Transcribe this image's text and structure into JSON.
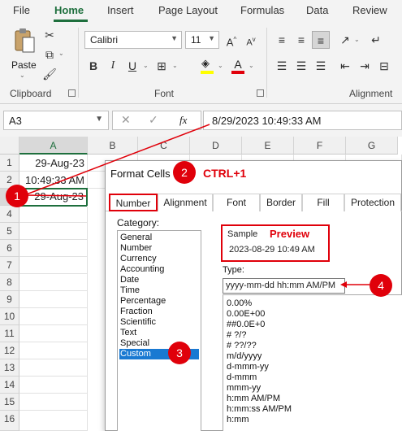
{
  "menu": {
    "tabs": [
      "File",
      "Home",
      "Insert",
      "Page Layout",
      "Formulas",
      "Data",
      "Review"
    ],
    "active": "Home"
  },
  "ribbon": {
    "clipboard": {
      "paste_label": "Paste",
      "group_label": "Clipboard"
    },
    "font": {
      "font_name": "Calibri",
      "font_size": "11",
      "group_label": "Font",
      "bold": "B",
      "italic": "I",
      "underline": "U",
      "grow": "A",
      "shrink": "A",
      "font_color_letter": "A"
    },
    "alignment": {
      "group_label": "Alignment"
    }
  },
  "formula_bar": {
    "name_box": "A3",
    "fx": "fx",
    "content": "8/29/2023  10:49:33 AM"
  },
  "grid": {
    "columns": [
      "A",
      "B",
      "C",
      "D",
      "E",
      "F",
      "G"
    ],
    "rows": [
      "1",
      "2",
      "3",
      "4",
      "5",
      "6",
      "7",
      "8",
      "9",
      "10",
      "11",
      "12",
      "13",
      "14",
      "15",
      "16"
    ],
    "cells": {
      "A1": "29-Aug-23",
      "A2": "10:49:33 AM",
      "A3": "29-Aug-23"
    }
  },
  "dialog": {
    "title": "Format Cells",
    "tabs": [
      "Number",
      "Alignment",
      "Font",
      "Border",
      "Fill",
      "Protection"
    ],
    "active_tab": "Number",
    "category_label": "Category:",
    "categories": [
      "General",
      "Number",
      "Currency",
      "Accounting",
      "Date",
      "Time",
      "Percentage",
      "Fraction",
      "Scientific",
      "Text",
      "Special",
      "Custom"
    ],
    "selected_category": "Custom",
    "sample_label": "Sample",
    "sample_value": "2023-08-29 10:49 AM",
    "type_label": "Type:",
    "type_value": "yyyy-mm-dd hh:mm AM/PM",
    "type_options": [
      "0.00%",
      "0.00E+00",
      "##0.0E+0",
      "# ?/?",
      "# ??/??",
      "m/d/yyyy",
      "d-mmm-yy",
      "d-mmm",
      "mmm-yy",
      "h:mm AM/PM",
      "h:mm:ss AM/PM",
      "h:mm"
    ]
  },
  "annotations": {
    "step1": "1",
    "step2": "2",
    "step3": "3",
    "step4": "4",
    "shortcut": "CTRL+1",
    "preview": "Preview"
  },
  "colors": {
    "excel_green": "#1e6f3d",
    "annotation_red": "#e0000a",
    "selection_blue": "#1979d2"
  }
}
